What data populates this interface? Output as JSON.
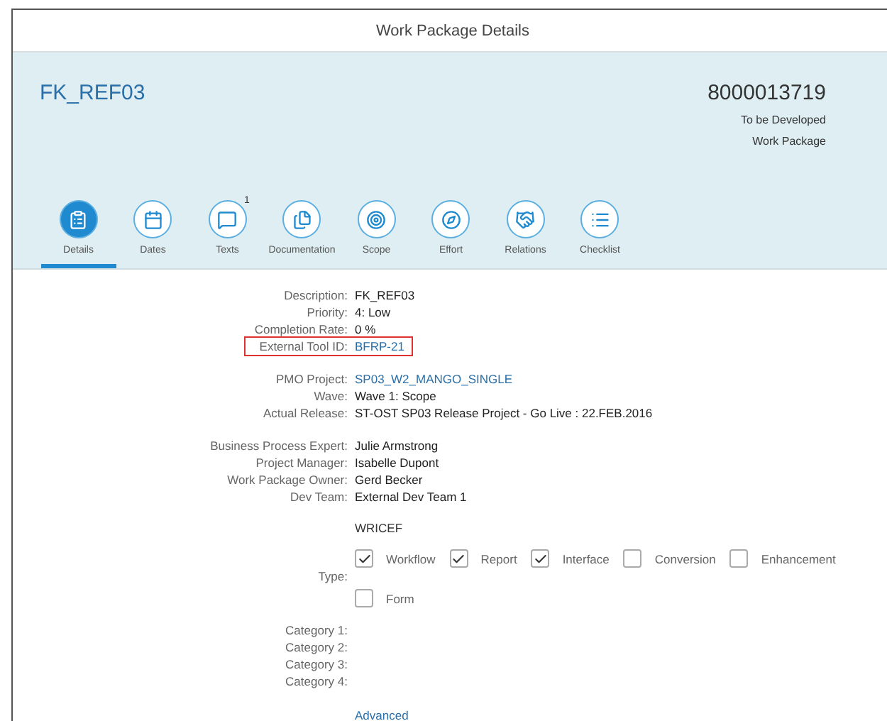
{
  "window": {
    "title": "Work Package Details"
  },
  "header": {
    "title": "FK_REF03",
    "number": "8000013719",
    "status": "To be Developed",
    "type": "Work Package"
  },
  "tabs": [
    {
      "label": "Details",
      "selected": true
    },
    {
      "label": "Dates",
      "selected": false
    },
    {
      "label": "Texts",
      "selected": false,
      "badge": "1"
    },
    {
      "label": "Documentation",
      "selected": false
    },
    {
      "label": "Scope",
      "selected": false
    },
    {
      "label": "Effort",
      "selected": false
    },
    {
      "label": "Relations",
      "selected": false
    },
    {
      "label": "Checklist",
      "selected": false
    }
  ],
  "field_groups": [
    [
      {
        "label": "Description:",
        "value": "FK_REF03",
        "kind": "text",
        "highlighted": false
      },
      {
        "label": "Priority:",
        "value": "4: Low",
        "kind": "text",
        "highlighted": false
      },
      {
        "label": "Completion Rate:",
        "value": "0 %",
        "kind": "text",
        "highlighted": false
      },
      {
        "label": "External Tool ID:",
        "value": "BFRP-21",
        "kind": "link",
        "highlighted": true
      }
    ],
    [
      {
        "label": "PMO Project:",
        "value": "SP03_W2_MANGO_SINGLE",
        "kind": "link",
        "highlighted": false
      },
      {
        "label": "Wave:",
        "value": "Wave 1: Scope",
        "kind": "text",
        "highlighted": false
      },
      {
        "label": "Actual Release:",
        "value": "ST-OST SP03 Release Project - Go Live : 22.FEB.2016",
        "kind": "text",
        "highlighted": false
      }
    ],
    [
      {
        "label": "Business Process Expert:",
        "value": "Julie Armstrong",
        "kind": "text",
        "highlighted": false
      },
      {
        "label": "Project Manager:",
        "value": "Isabelle Dupont",
        "kind": "text",
        "highlighted": false
      },
      {
        "label": "Work Package Owner:",
        "value": "Gerd Becker",
        "kind": "text",
        "highlighted": false
      },
      {
        "label": "Dev Team:",
        "value": "External Dev Team 1",
        "kind": "text",
        "highlighted": false
      }
    ]
  ],
  "wricef": {
    "heading": "WRICEF",
    "type_label": "Type:",
    "options": [
      {
        "label": "Workflow",
        "checked": true
      },
      {
        "label": "Report",
        "checked": true
      },
      {
        "label": "Interface",
        "checked": true
      },
      {
        "label": "Conversion",
        "checked": false
      },
      {
        "label": "Enhancement",
        "checked": false
      },
      {
        "label": "Form",
        "checked": false
      }
    ]
  },
  "categories": [
    {
      "label": "Category 1:"
    },
    {
      "label": "Category 2:"
    },
    {
      "label": "Category 3:"
    },
    {
      "label": "Category 4:"
    }
  ],
  "advanced_link": "Advanced"
}
